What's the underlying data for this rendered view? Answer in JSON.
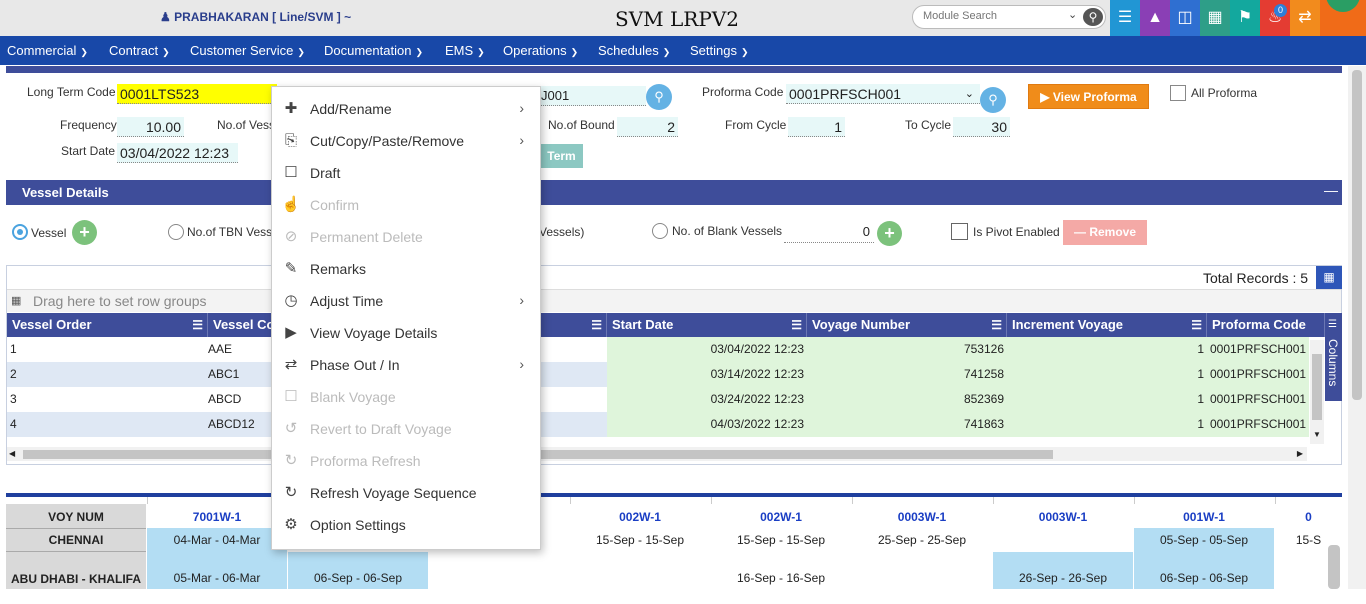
{
  "header": {
    "user": "PRABHAKARAN [ Line/SVM ] ~",
    "app_title": "SVM LRPV2",
    "module_search_placeholder": "Module Search",
    "notification_count": "0",
    "tile_colors": [
      "#2196d4",
      "#8a3fb5",
      "#2f6fd1",
      "#2e9e88",
      "#13a89e",
      "#e43c32",
      "#f28b1d",
      "#f06b18"
    ]
  },
  "menu": [
    {
      "label": "Commercial"
    },
    {
      "label": "Contract"
    },
    {
      "label": "Customer Service"
    },
    {
      "label": "Documentation"
    },
    {
      "label": "EMS"
    },
    {
      "label": "Operations"
    },
    {
      "label": "Schedules"
    },
    {
      "label": "Settings"
    }
  ],
  "form": {
    "long_term_code_label": "Long Term Code",
    "long_term_code_value": "0001LTS523",
    "service_code_partial": "J001",
    "proforma_code_label": "Proforma Code",
    "proforma_code_value": "0001PRFSCH001",
    "view_proforma_label": "View Proforma",
    "all_proforma_label": "All Proforma",
    "frequency_label": "Frequency",
    "frequency_value": "10.00",
    "no_of_vessels_label": "No.of Vess",
    "no_of_bound_label": "No.of Bound",
    "no_of_bound_value": "2",
    "from_cycle_label": "From Cycle",
    "from_cycle_value": "1",
    "to_cycle_label": "To Cycle",
    "to_cycle_value": "30",
    "start_date_label": "Start Date",
    "start_date_value": "03/04/2022 12:23",
    "term_button_partial": "Term"
  },
  "vessel_details": {
    "title": "Vessel Details",
    "collapse": "—",
    "vessel_radio": "Vessel",
    "tbn_radio": "No.of TBN Vess",
    "vessels_partial": "Vessels)",
    "blank_radio": "No. of Blank Vessels",
    "blank_value": "0",
    "pivot_label": "Is Pivot Enabled",
    "remove_label": "Remove",
    "total_records": "Total Records : 5",
    "drag_hint": "Drag here to set row groups",
    "columns_label": "Columns",
    "headers": [
      "Vessel Order",
      "Vessel Co",
      "",
      "Start Date",
      "Voyage Number",
      "Increment Voyage",
      "Proforma Code"
    ],
    "rows": [
      {
        "order": "1",
        "code": "AAE",
        "start": "03/04/2022 12:23",
        "voyage": "753126",
        "inc": "1",
        "proforma": "0001PRFSCH001"
      },
      {
        "order": "2",
        "code": "ABC1",
        "start": "03/14/2022 12:23",
        "voyage": "741258",
        "inc": "1",
        "proforma": "0001PRFSCH001"
      },
      {
        "order": "3",
        "code": "ABCD",
        "start": "03/24/2022 12:23",
        "voyage": "852369",
        "inc": "1",
        "proforma": "0001PRFSCH001"
      },
      {
        "order": "4",
        "code": "ABCD12",
        "start": "04/03/2022 12:23",
        "voyage": "741863",
        "inc": "1",
        "proforma": "0001PRFSCH001"
      }
    ]
  },
  "schedule": {
    "row_headers": [
      "VOY NUM",
      "CHENNAI",
      "ABU DHABI - KHALIFA"
    ],
    "voyages": [
      "7001W-1",
      "",
      "",
      "002W-1",
      "002W-1",
      "0003W-1",
      "0003W-1",
      "001W-1",
      "0"
    ],
    "chennai": [
      "04-Mar - 04-Mar",
      "",
      "",
      "15-Sep - 15-Sep",
      "15-Sep - 15-Sep",
      "25-Sep - 25-Sep",
      "",
      "05-Sep - 05-Sep",
      "15-S"
    ],
    "abudhabi": [
      "05-Mar - 06-Mar",
      "06-Sep - 06-Sep",
      "",
      "",
      "16-Sep - 16-Sep",
      "",
      "26-Sep - 26-Sep",
      "06-Sep - 06-Sep",
      ""
    ]
  },
  "context_menu": [
    {
      "label": "Add/Rename",
      "icon": "plus-icon",
      "disabled": false,
      "submenu": true
    },
    {
      "label": "Cut/Copy/Paste/Remove",
      "icon": "copy-icon",
      "disabled": false,
      "submenu": true
    },
    {
      "label": "Draft",
      "icon": "document-icon",
      "disabled": false,
      "submenu": false
    },
    {
      "label": "Confirm",
      "icon": "thumbs-up-icon",
      "disabled": true,
      "submenu": false
    },
    {
      "label": "Permanent Delete",
      "icon": "ban-icon",
      "disabled": true,
      "submenu": false
    },
    {
      "label": "Remarks",
      "icon": "edit-icon",
      "disabled": false,
      "submenu": false
    },
    {
      "label": "Adjust Time",
      "icon": "clock-icon",
      "disabled": false,
      "submenu": true
    },
    {
      "label": "View Voyage Details",
      "icon": "play-circle-icon",
      "disabled": false,
      "submenu": false
    },
    {
      "label": "Phase Out / In",
      "icon": "exchange-icon",
      "disabled": false,
      "submenu": true
    },
    {
      "label": "Blank Voyage",
      "icon": "file-icon",
      "disabled": true,
      "submenu": false
    },
    {
      "label": "Revert to Draft Voyage",
      "icon": "undo-icon",
      "disabled": true,
      "submenu": false
    },
    {
      "label": "Proforma Refresh",
      "icon": "refresh-icon",
      "disabled": true,
      "submenu": false
    },
    {
      "label": "Refresh Voyage Sequence",
      "icon": "refresh-icon",
      "disabled": false,
      "submenu": false
    },
    {
      "label": "Option Settings",
      "icon": "cogs-icon",
      "disabled": false,
      "submenu": false
    }
  ]
}
